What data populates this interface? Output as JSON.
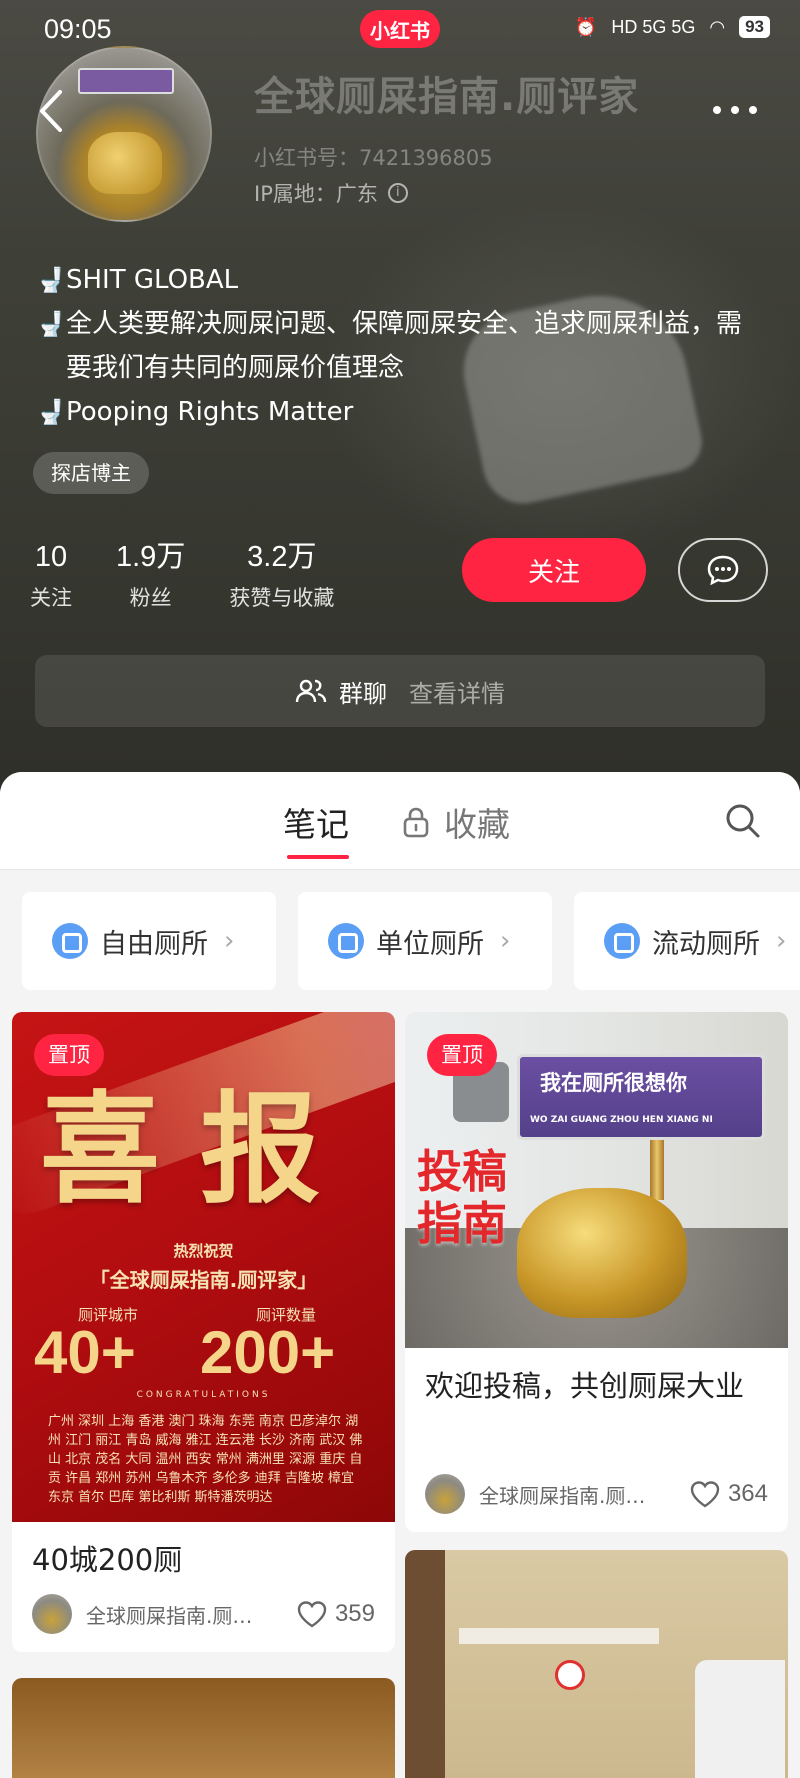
{
  "status_bar": {
    "time": "09:05",
    "app_badge": "小红书",
    "network": "HD 5G 5G",
    "battery": "93"
  },
  "profile": {
    "nickname": "全球厕屎指南.厕评家",
    "red_id": "小红书号：7421396805",
    "ip_location": "IP属地：广东",
    "bio_lines": [
      "SHIT GLOBAL",
      "全人类要解决厕屎问题、保障厕屎安全、追求厕屎利益，需要我们有共同的厕屎价值理念",
      "Pooping Rights Matter"
    ],
    "tag": "探店博主",
    "stats": [
      {
        "value": "10",
        "label": "关注"
      },
      {
        "value": "1.9万",
        "label": "粉丝"
      },
      {
        "value": "3.2万",
        "label": "获赞与收藏"
      }
    ],
    "follow_label": "关注",
    "group_chat": {
      "title": "群聊",
      "detail": "查看详情"
    }
  },
  "tabs": {
    "notes": "笔记",
    "favorites": "收藏"
  },
  "categories": [
    {
      "label": "自由厕所"
    },
    {
      "label": "单位厕所"
    },
    {
      "label": "流动厕所"
    }
  ],
  "posts": [
    {
      "pinned_label": "置顶",
      "cover": {
        "headline": "喜报",
        "congrats_small": "热烈祝贺",
        "congrats_name": "「全球厕屎指南.厕评家」",
        "metric1_label": "厕评城市",
        "metric1_value": "40+",
        "metric2_label": "厕评数量",
        "metric2_value": "200+",
        "congrats_en": "CONGRATULATIONS",
        "cities": "广州 深圳 上海 香港 澳门 珠海 东莞 南京 巴彦淖尔 湖州 江门 丽江 青岛 威海 雅江 连云港 长沙 济南 武汉 佛山 北京 茂名 大同 温州 西安 常州 满洲里 深源 重庆 自贡 许昌 郑州 苏州 乌鲁木齐 多伦多 迪拜 吉隆坡 樟宜 东京 首尔 巴库 第比利斯 斯特潘茨明达"
      },
      "title": "40城200厕",
      "author": "全球厕屎指南.厕评家",
      "likes": "359"
    },
    {
      "pinned_label": "置顶",
      "cover": {
        "sign_text": "我在厕所很想你",
        "sign_sub": "WO ZAI GUANG ZHOU HEN XIANG NI",
        "overlay_text": "投稿\n指南"
      },
      "title": "欢迎投稿，共创厕屎大业",
      "author": "全球厕屎指南.厕评家",
      "likes": "364"
    }
  ],
  "colors": {
    "brand_red": "#ff2442",
    "chip_icon_blue": "#5b9ef5"
  },
  "icons": [
    "back-arrow-icon",
    "more-dots-icon",
    "info-icon",
    "toilet-icon",
    "chat-bubble-icon",
    "group-people-icon",
    "lock-icon",
    "search-icon",
    "chevron-right-icon",
    "heart-icon"
  ]
}
